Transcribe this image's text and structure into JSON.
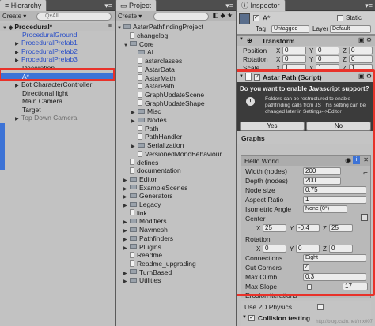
{
  "hierarchy": {
    "tab_label": "Hierarchy",
    "create_label": "Create ▾",
    "search_placeholder": "Q▾All",
    "root": "Procedural*",
    "items": [
      {
        "label": "ProceduralGround"
      },
      {
        "label": "ProceduralPrefab1"
      },
      {
        "label": "ProceduralPrefab2"
      },
      {
        "label": "ProceduralPrefab3"
      },
      {
        "label": "Decoration"
      },
      {
        "label": "A*"
      },
      {
        "label": "Bot CharacterController"
      },
      {
        "label": "Directional light"
      },
      {
        "label": "Main Camera"
      },
      {
        "label": "Target"
      },
      {
        "label": "Top Down Camera"
      }
    ]
  },
  "project": {
    "tab_label": "Project",
    "create_label": "Create ▾",
    "root": "AstarPathfindingProject",
    "items": [
      {
        "label": "changelog"
      },
      {
        "label": "Core"
      },
      {
        "label": "AI"
      },
      {
        "label": "astarclasses"
      },
      {
        "label": "AstarData"
      },
      {
        "label": "AstarMath"
      },
      {
        "label": "AstarPath"
      },
      {
        "label": "GraphUpdateScene"
      },
      {
        "label": "GraphUpdateShape"
      },
      {
        "label": "Misc"
      },
      {
        "label": "Nodes"
      },
      {
        "label": "Path"
      },
      {
        "label": "PathHandler"
      },
      {
        "label": "Serialization"
      },
      {
        "label": "VersionedMonoBehaviour"
      },
      {
        "label": "defines"
      },
      {
        "label": "documentation"
      },
      {
        "label": "Editor"
      },
      {
        "label": "ExampleScenes"
      },
      {
        "label": "Generators"
      },
      {
        "label": "Legacy"
      },
      {
        "label": "link"
      },
      {
        "label": "Modifiers"
      },
      {
        "label": "Navmesh"
      },
      {
        "label": "Pathfinders"
      },
      {
        "label": "Plugins"
      },
      {
        "label": "Readme"
      },
      {
        "label": "Readme_upgrading"
      },
      {
        "label": "TurnBased"
      },
      {
        "label": "Utilities"
      }
    ]
  },
  "inspector": {
    "tab_label": "Inspector",
    "object_name": "A*",
    "static_label": "Static",
    "tag_label": "Tag",
    "tag_value": "Untagged",
    "layer_label": "Layer",
    "layer_value": "Default",
    "transform": {
      "title": "Transform",
      "position_label": "Position",
      "rotation_label": "Rotation",
      "scale_label": "Scale",
      "axis_x": "X",
      "axis_y": "Y",
      "axis_z": "Z",
      "position": [
        "0",
        "0",
        "0"
      ],
      "rotation": [
        "0",
        "0",
        "0"
      ],
      "scale": [
        "1",
        "1",
        "1"
      ]
    },
    "component": {
      "title": "Astar Path (Script)",
      "question": "Do you want to enable Javascript support?",
      "info_text": "Folders can be restructured to enable pathfinding calls from JS This setting can be changed later in Settings-->Editor",
      "yes_label": "Yes",
      "no_label": "No"
    },
    "graphs": {
      "header": "Graphs",
      "graph_name": "Hello World",
      "width_label": "Width (nodes)",
      "width_value": "200",
      "depth_label": "Depth (nodes)",
      "depth_value": "200",
      "node_size_label": "Node size",
      "node_size_value": "0.75",
      "aspect_label": "Aspect Ratio",
      "aspect_value": "1",
      "iso_label": "Isometric Angle",
      "iso_value": "None (0°)",
      "center_label": "Center",
      "center": [
        "25",
        "-0.4",
        "25"
      ],
      "rotation_label": "Rotation",
      "rotation": [
        "0",
        "0",
        "0"
      ],
      "connections_label": "Connections",
      "connections_value": "Eight",
      "cut_corners_label": "Cut Corners",
      "max_climb_label": "Max Climb",
      "max_climb_value": "0.3",
      "max_slope_label": "Max Slope",
      "max_slope_value": "17",
      "erosion_label": "Erosion iterations",
      "use2d_label": "Use 2D Physics",
      "collision_label": "Collision testing"
    }
  },
  "watermark": "http://blog.csdn.net/jmx007",
  "colors": {
    "highlight": "#e8322a",
    "prefab_blue": "#2a4fc8",
    "selection": "#3d73d6"
  }
}
